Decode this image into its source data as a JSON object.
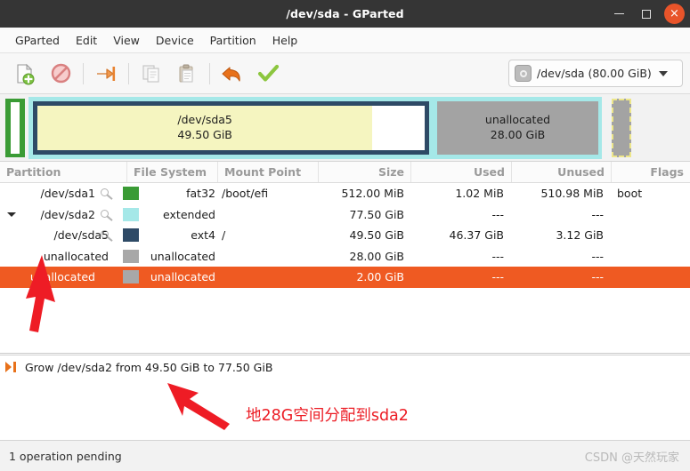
{
  "window": {
    "title": "/dev/sda - GParted",
    "minimize_label": "—",
    "maximize_label": "□",
    "close_label": "×"
  },
  "menubar": {
    "items": [
      {
        "label": "GParted"
      },
      {
        "label": "Edit"
      },
      {
        "label": "View"
      },
      {
        "label": "Device"
      },
      {
        "label": "Partition"
      },
      {
        "label": "Help"
      }
    ]
  },
  "toolbar": {
    "buttons": [
      {
        "name": "new-partition-button",
        "icon": "new-document-icon"
      },
      {
        "name": "delete-partition-button",
        "icon": "delete-forbidden-icon"
      },
      {
        "name": "resize-move-button",
        "icon": "resize-arrow-icon"
      },
      {
        "name": "copy-button",
        "icon": "copy-icon"
      },
      {
        "name": "paste-button",
        "icon": "paste-icon"
      },
      {
        "name": "undo-button",
        "icon": "undo-arrow-icon"
      },
      {
        "name": "apply-button",
        "icon": "apply-check-icon"
      }
    ],
    "device_select": {
      "label": "/dev/sda (80.00 GiB)",
      "icon": "disk-icon"
    }
  },
  "graphic": {
    "sda1": {
      "label": "",
      "color": "#3a9b35"
    },
    "extended": {
      "color": "#a5e8e8"
    },
    "sda5": {
      "name": "/dev/sda5",
      "size": "49.50 GiB",
      "color": "#f5f5c0",
      "border": "#2e4a66"
    },
    "unallocated": {
      "name": "unallocated",
      "size": "28.00 GiB",
      "color": "#a3a3a3"
    },
    "unallocated_small": {
      "color": "#a3a3a3",
      "dash": "#ede68a"
    }
  },
  "table": {
    "headers": [
      "Partition",
      "File System",
      "Mount Point",
      "Size",
      "Used",
      "Unused",
      "Flags"
    ],
    "rows": [
      {
        "partition": "/dev/sda1",
        "has_key": true,
        "expander": false,
        "indent": 0,
        "swatch": "#3a9b35",
        "filesystem": "fat32",
        "mountpoint": "/boot/efi",
        "size": "512.00 MiB",
        "used": "1.02 MiB",
        "unused": "510.98 MiB",
        "flags": "boot",
        "selected": false
      },
      {
        "partition": "/dev/sda2",
        "has_key": true,
        "expander": true,
        "indent": 0,
        "swatch": "#a5e8e8",
        "filesystem": "extended",
        "mountpoint": "",
        "size": "77.50 GiB",
        "used": "---",
        "unused": "---",
        "flags": "",
        "selected": false
      },
      {
        "partition": "/dev/sda5",
        "has_key": true,
        "expander": false,
        "indent": 1,
        "swatch": "#2e4a66",
        "filesystem": "ext4",
        "mountpoint": "/",
        "size": "49.50 GiB",
        "used": "46.37 GiB",
        "unused": "3.12 GiB",
        "flags": "",
        "selected": false
      },
      {
        "partition": "unallocated",
        "has_key": false,
        "expander": false,
        "indent": 1,
        "swatch": "#a8a8a8",
        "filesystem": "unallocated",
        "mountpoint": "",
        "size": "28.00 GiB",
        "used": "---",
        "unused": "---",
        "flags": "",
        "selected": false
      },
      {
        "partition": "unallocated",
        "has_key": false,
        "expander": false,
        "indent": 0,
        "swatch": "#a8a8a8",
        "filesystem": "unallocated",
        "mountpoint": "",
        "size": "2.00 GiB",
        "used": "---",
        "unused": "---",
        "flags": "",
        "selected": true
      }
    ]
  },
  "operations": {
    "items": [
      {
        "icon": "grow-icon",
        "text": "Grow /dev/sda2 from 49.50 GiB to 77.50 GiB"
      }
    ]
  },
  "statusbar": {
    "pending": "1 operation pending",
    "watermark": "CSDN @天然玩家"
  },
  "annotations": {
    "note": "地28G空间分配到sda2",
    "color": "#ec1c24"
  }
}
